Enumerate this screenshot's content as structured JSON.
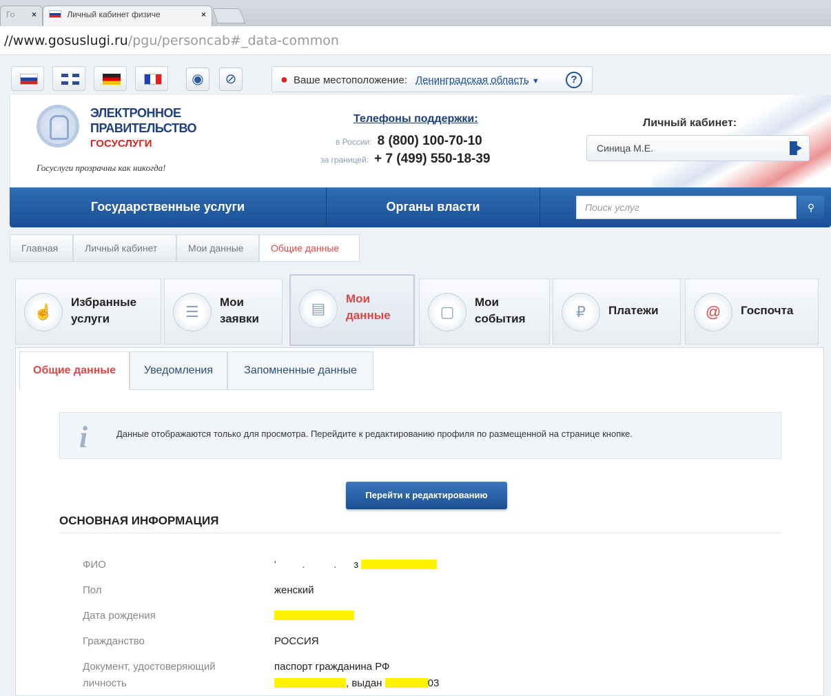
{
  "browser": {
    "tabs": [
      {
        "label": "Го",
        "close": "×"
      },
      {
        "label": "Личный кабинет физиче",
        "close": "×"
      }
    ],
    "url_host": "//www.gosuslugi.ru",
    "url_path": "/pgu/personcab#_data-common"
  },
  "topbar": {
    "languages": [
      "ru",
      "en",
      "de",
      "fr"
    ],
    "location_label": "Ваше местоположение:",
    "location_value": "Ленинградская область",
    "help_icon": "?"
  },
  "header": {
    "logo_line1": "ЭЛЕКТРОННОЕ",
    "logo_line2": "ПРАВИТЕЛЬСТВО",
    "logo_line3": "ГОСУСЛУГИ",
    "slogan": "Госуслуги прозрачны как никогда!",
    "phones_title": "Телефоны поддержки:",
    "phone_russia_label": "в России:",
    "phone_russia": "8 (800) 100-70-10",
    "phone_abroad_label": "за границей:",
    "phone_abroad": "+ 7 (499) 550-18-39",
    "cabinet_title": "Личный кабинет:",
    "cabinet_user": "Синица М.Е."
  },
  "nav": {
    "items": [
      "Государственные услуги",
      "Органы власти"
    ],
    "search_placeholder": "Поиск услуг"
  },
  "breadcrumb": [
    "Главная",
    "Личный кабинет",
    "Мои данные",
    "Общие данные"
  ],
  "tiles": [
    {
      "label": "Избранные\nуслуги",
      "icon": "favorites-icon"
    },
    {
      "label": "Мои\nзаявки",
      "icon": "requests-icon"
    },
    {
      "label": "Мои\nданные",
      "icon": "mydata-icon",
      "active": true
    },
    {
      "label": "Мои\nсобытия",
      "icon": "calendar-icon"
    },
    {
      "label": "Платежи",
      "icon": "payments-icon"
    },
    {
      "label": "Госпочта",
      "icon": "mail-icon"
    }
  ],
  "subtabs": [
    "Общие данные",
    "Уведомления",
    "Запомненные данные"
  ],
  "info_text": "Данные отображаются только для просмотра. Перейдите к редактированию профиля по размещенной на странице кнопке.",
  "edit_button": "Перейти к редактированию",
  "section_title": "ОСНОВНАЯ ИНФОРМАЦИЯ",
  "fields": {
    "fio_label": "ФИО",
    "fio_value_tail": "з",
    "gender_label": "Пол",
    "gender_value": "женский",
    "birth_label": "Дата рождения",
    "citizenship_label": "Гражданство",
    "citizenship_value": "РОССИЯ",
    "doc_label": "Документ, удостоверяющий личность",
    "doc_value": "паспорт гражданина РФ",
    "doc_issued": ", выдан",
    "doc_tail": "03"
  },
  "colors": {
    "accent_blue": "#1d4f9a",
    "accent_red": "#e04545",
    "redaction_yellow": "#fff200"
  }
}
